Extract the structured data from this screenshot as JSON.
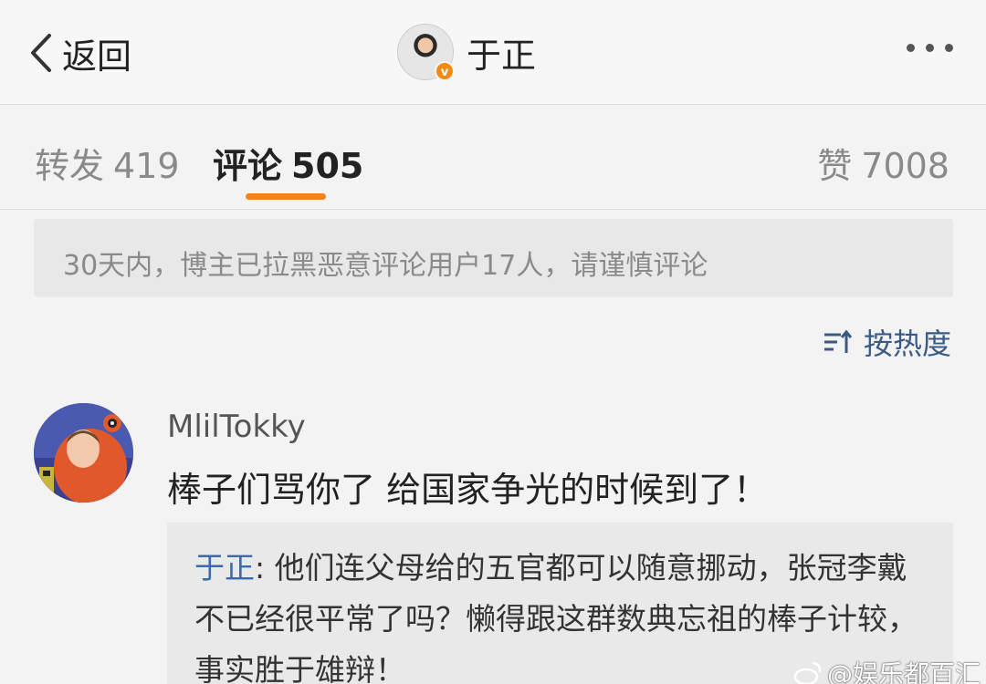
{
  "header": {
    "back_label": "返回",
    "profile_name": "于正",
    "verified_badge": "v"
  },
  "tabs": {
    "repost": {
      "label": "转发",
      "count": "419"
    },
    "comment": {
      "label": "评论",
      "count": "505"
    },
    "like": {
      "label": "赞",
      "count": "7008"
    }
  },
  "notice": {
    "text": "30天内，博主已拉黑恶意评论用户17人，请谨慎评论"
  },
  "sort": {
    "label": "按热度"
  },
  "comment": {
    "username": "MlilTokky",
    "text": "棒子们骂你了 给国家争光的时候到了！",
    "reply": {
      "author": "于正",
      "separator": ": ",
      "text": "他们连父母给的五官都可以随意挪动，张冠李戴不已经很平常了吗？懒得跟这群数典忘祖的棒子计较，事实胜于雄辩！"
    }
  },
  "watermark": {
    "text": "@娱乐都百汇"
  },
  "colors": {
    "accent": "#f0841e",
    "link": "#3a6aa8",
    "background": "#f3f3f3"
  }
}
